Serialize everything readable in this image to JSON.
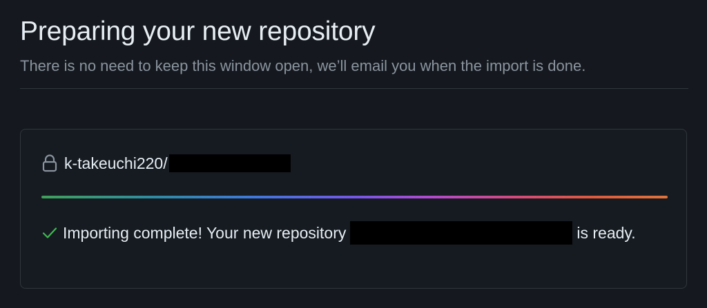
{
  "header": {
    "title": "Preparing your new repository",
    "subtitle": "There is no need to keep this window open, we’ll email you when the import is done."
  },
  "card": {
    "repo_owner": "k-takeuchi220/",
    "repo_name_redacted": true,
    "progress_percent": 100,
    "status_icon": "check-icon",
    "message_prefix": "Importing complete! Your new repository",
    "message_suffix": "is ready.",
    "lock_icon": "lock-icon"
  },
  "colors": {
    "background": "#15191f",
    "card_background": "#161b22",
    "border": "#30363d",
    "text_primary": "#e6edf3",
    "text_muted": "#8b949e",
    "success": "#3fb950"
  }
}
